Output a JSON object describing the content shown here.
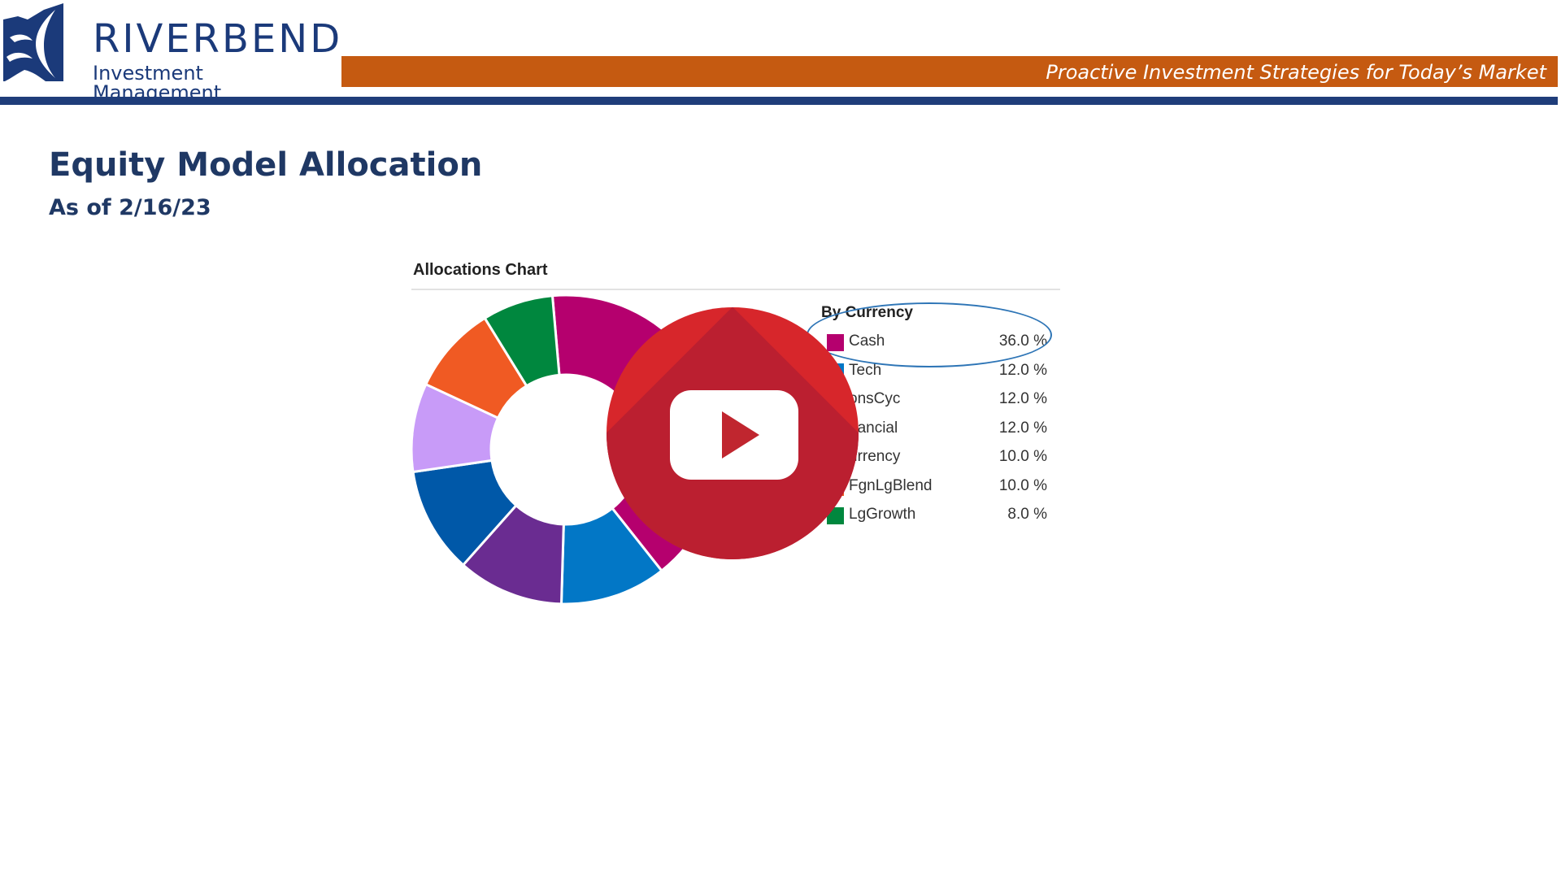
{
  "header": {
    "logo_name": "RIVERBEND",
    "logo_subtitle": "Investment Management",
    "tagline": "Proactive Investment Strategies for Today’s Market",
    "brand_colors": {
      "navy": "#1f3d7a",
      "orange": "#c55a11",
      "title": "#1f3864"
    }
  },
  "page": {
    "title": "Equity Model Allocation",
    "subtitle": "As of 2/16/23"
  },
  "chart": {
    "panel_title": "Allocations Chart",
    "legend_header": "By Currency"
  },
  "chart_data": {
    "type": "pie",
    "style": "donut",
    "title": "Allocations Chart",
    "legend_title": "By Currency",
    "legend_position": "right",
    "categories": [
      "Cash",
      "Tech",
      "ConsCyc",
      "Financial",
      "Currency",
      "FgnLgBlend",
      "LgGrowth"
    ],
    "categories_visible_text": [
      "Cash",
      "Tech",
      "onsCyc",
      "nancial",
      "urrency",
      "FgnLgBlend",
      "LgGrowth"
    ],
    "values": [
      36.0,
      12.0,
      12.0,
      12.0,
      10.0,
      10.0,
      8.0
    ],
    "value_labels": [
      "36.0 %",
      "12.0 %",
      "12.0 %",
      "12.0 %",
      "10.0 %",
      "10.0 %",
      "8.0 %"
    ],
    "legend_colors": [
      "#b5006e",
      "#0277c6",
      "#6a2c91",
      "#0058a8",
      "#c89bf8",
      "#f05a23",
      "#00873e"
    ],
    "ring_segments": [
      {
        "name": "Cash (behind overlay)",
        "share": 36.0,
        "color": "#b5006e"
      },
      {
        "name": "magenta",
        "share": 8.0,
        "color": "#b5006e"
      },
      {
        "name": "blue",
        "share": 12.0,
        "color": "#0277c6"
      },
      {
        "name": "purple",
        "share": 12.0,
        "color": "#6a2c91"
      },
      {
        "name": "navy",
        "share": 12.0,
        "color": "#0058a8"
      },
      {
        "name": "lavender",
        "share": 10.0,
        "color": "#c89bf8"
      },
      {
        "name": "orange",
        "share": 10.0,
        "color": "#f05a23"
      },
      {
        "name": "green",
        "share": 8.0,
        "color": "#00873e"
      }
    ]
  },
  "overlay": {
    "icon": "play-icon",
    "colors": {
      "circle": "#d7262b",
      "shade": "#bb1f30",
      "button": "#ffffff"
    }
  }
}
